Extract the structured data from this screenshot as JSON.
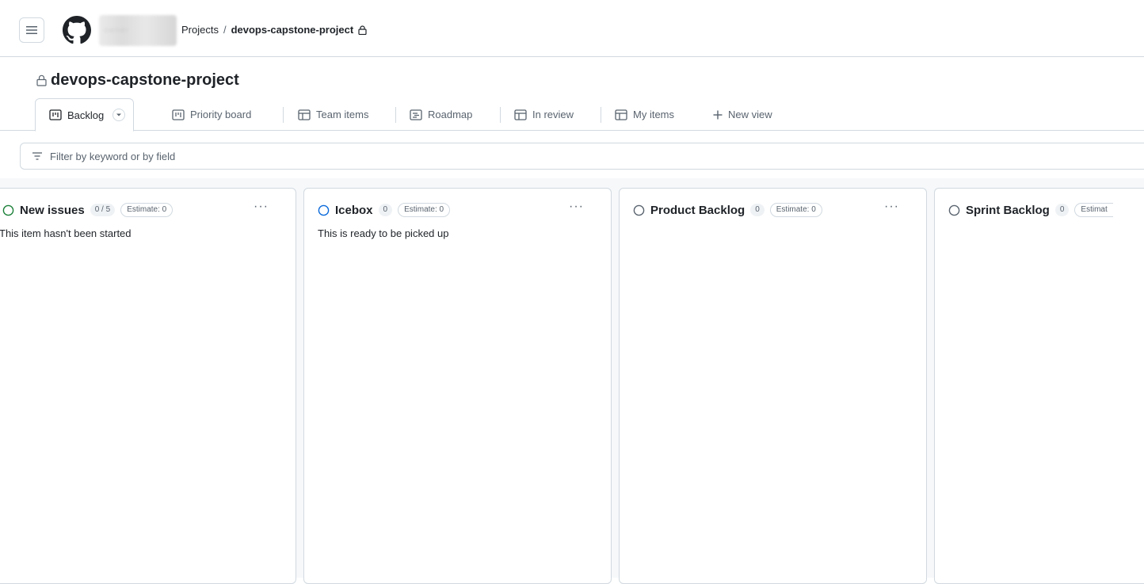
{
  "header": {
    "owner_name": "owner",
    "breadcrumb_projects": "Projects",
    "breadcrumb_separator": "/",
    "breadcrumb_project": "devops-capstone-project"
  },
  "project": {
    "title": "devops-capstone-project"
  },
  "tabs": [
    {
      "label": "Backlog",
      "icon": "board-icon",
      "active": true
    },
    {
      "label": "Priority board",
      "icon": "board-icon"
    },
    {
      "label": "Team items",
      "icon": "table-icon"
    },
    {
      "label": "Roadmap",
      "icon": "roadmap-icon"
    },
    {
      "label": "In review",
      "icon": "table-icon"
    },
    {
      "label": "My items",
      "icon": "table-icon"
    }
  ],
  "new_view": {
    "label": "New view",
    "icon": "plus-icon"
  },
  "filter": {
    "placeholder": "Filter by keyword or by field",
    "icon": "filter-icon"
  },
  "columns": [
    {
      "name": "New issues",
      "count": "0 / 5",
      "estimate": "Estimate: 0",
      "description": "This item hasn't been started",
      "status_color": "#1a7f37"
    },
    {
      "name": "Icebox",
      "count": "0",
      "estimate": "Estimate: 0",
      "description": "This is ready to be picked up",
      "status_color": "#0969da"
    },
    {
      "name": "Product Backlog",
      "count": "0",
      "estimate": "Estimate: 0",
      "description": "",
      "status_color": "#59636e"
    },
    {
      "name": "Sprint Backlog",
      "count": "0",
      "estimate": "Estimat",
      "description": "",
      "status_color": "#59636e"
    }
  ],
  "column_menu_label": "···"
}
